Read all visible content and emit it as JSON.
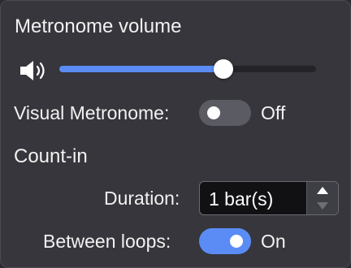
{
  "panel": {
    "title": "Metronome volume"
  },
  "volume": {
    "icon": "speaker-icon",
    "level": 0.64,
    "accent_color": "#5b8cf5"
  },
  "visual_metronome": {
    "label": "Visual Metronome:",
    "state": "Off"
  },
  "count_in": {
    "heading": "Count-in",
    "duration_label": "Duration:",
    "duration_value": "1 bar(s)",
    "between_loops_label": "Between loops:",
    "between_loops_state": "On"
  }
}
